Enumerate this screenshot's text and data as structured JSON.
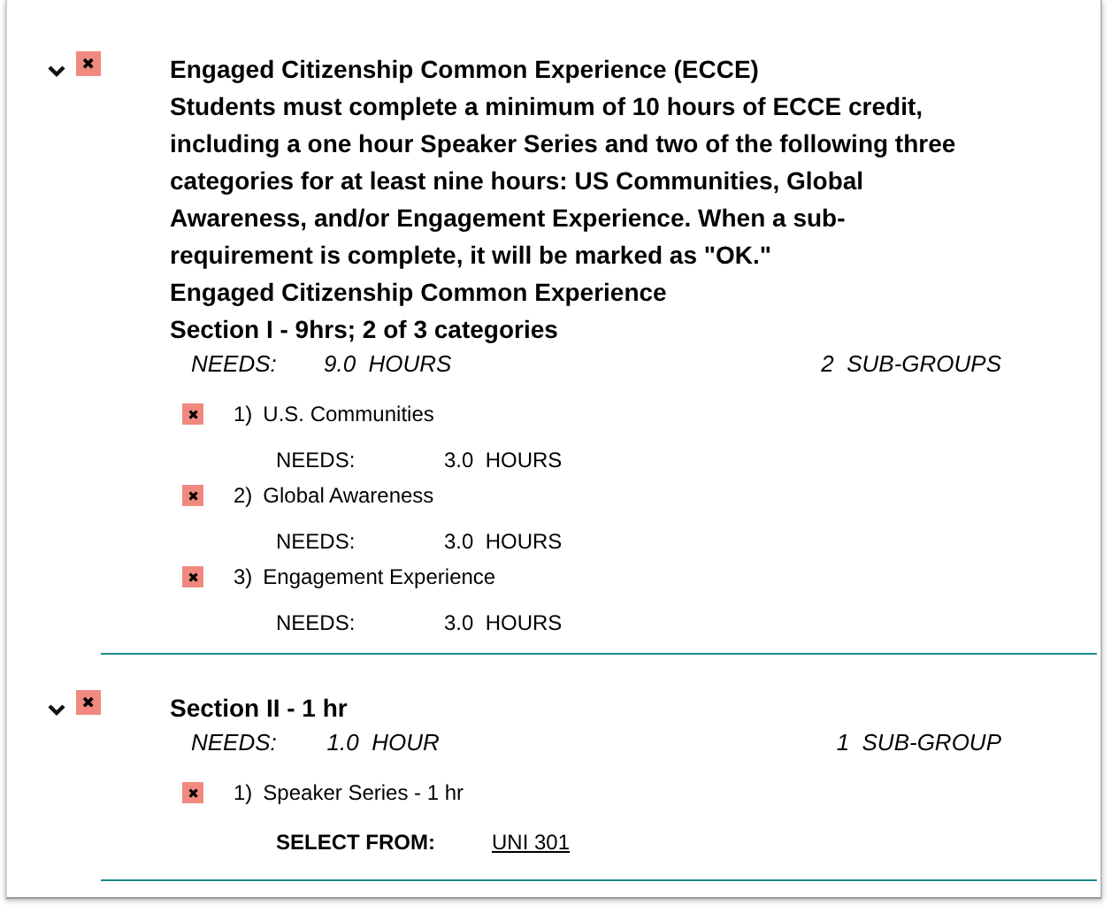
{
  "requirements": [
    {
      "expanded": true,
      "complete": false,
      "headings": [
        "Engaged Citizenship Common Experience (ECCE)",
        "Students must complete a minimum of 10 hours of ECCE credit, including a one hour Speaker Series and two of the following three categories for at least nine hours: US Communities, Global Awareness, and/or Engagement Experience. When a sub-requirement is complete, it will be marked as \"OK.\"",
        "Engaged Citizenship Common Experience",
        "Section I - 9hrs; 2 of 3 categories"
      ],
      "needs": {
        "label": "NEEDS:",
        "amount": "9.0",
        "unit": "HOURS",
        "groups": "2",
        "groups_unit": "SUB-GROUPS"
      },
      "subs": [
        {
          "complete": false,
          "number": "1)",
          "name": "U.S. Communities",
          "detail": {
            "kind": "needs",
            "label": "NEEDS:",
            "amount": "3.0",
            "unit": "HOURS"
          }
        },
        {
          "complete": false,
          "number": "2)",
          "name": "Global Awareness",
          "detail": {
            "kind": "needs",
            "label": "NEEDS:",
            "amount": "3.0",
            "unit": "HOURS"
          }
        },
        {
          "complete": false,
          "number": "3)",
          "name": "Engagement Experience",
          "detail": {
            "kind": "needs",
            "label": "NEEDS:",
            "amount": "3.0",
            "unit": "HOURS"
          }
        }
      ]
    },
    {
      "expanded": true,
      "complete": false,
      "headings": [
        "Section II - 1 hr"
      ],
      "needs": {
        "label": "NEEDS:",
        "amount": "1.0",
        "unit": "HOUR",
        "groups": "1",
        "groups_unit": "SUB-GROUP"
      },
      "subs": [
        {
          "complete": false,
          "number": "1)",
          "name": "Speaker Series - 1 hr",
          "detail": {
            "kind": "select",
            "label": "SELECT FROM:",
            "course": "UNI 301"
          }
        }
      ]
    }
  ]
}
